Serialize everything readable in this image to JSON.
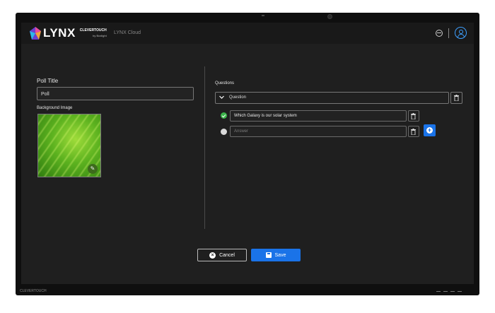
{
  "header": {
    "logo_text": "LYNX",
    "logo_sub_brand": "CLEVERTOUCH",
    "logo_sub_tag": "by Boxlight",
    "cloud_label": "LYNX Cloud",
    "icons": [
      "globe-icon",
      "user-icon"
    ]
  },
  "form": {
    "poll_title_label": "Poll Title",
    "poll_title_value": "Poll",
    "background_image_label": "Background Image"
  },
  "questions": {
    "label": "Questions",
    "question_header": "Question",
    "answers": [
      {
        "text": "Which Galaxy is our solar system",
        "correct": true
      },
      {
        "placeholder": "Answer",
        "correct": false
      }
    ]
  },
  "actions": {
    "cancel_label": "Cancel",
    "save_label": "Save"
  },
  "device": {
    "brand": "CLEVERTOUCH"
  },
  "colors": {
    "accent": "#1a73e8",
    "correct": "#3bb34a",
    "background": "#1f1f1f"
  }
}
